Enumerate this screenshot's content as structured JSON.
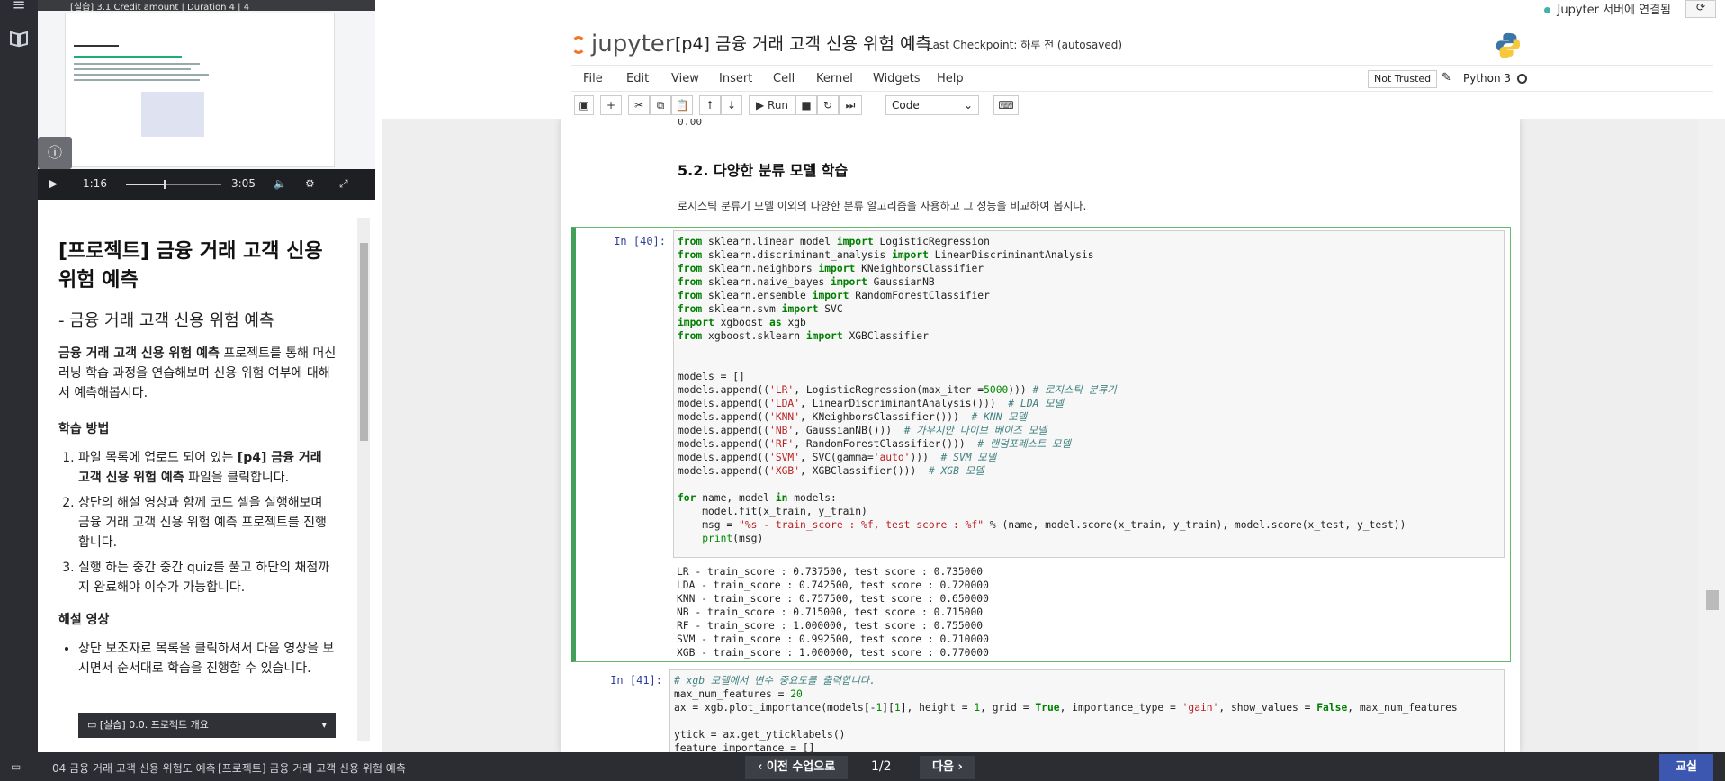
{
  "rail": {
    "icons": [
      "menu-icon",
      "book-icon"
    ]
  },
  "video": {
    "thumb_title": "[실습] 3.1 Credit amount | Duration 4 | 4",
    "current_time": "1:16",
    "total_time": "3:05",
    "progress": 0.41
  },
  "lesson": {
    "title": "[프로젝트] 금융 거래 고객 신용 위험 예측",
    "subtitle": "- 금융 거래 고객 신용 위험 예측",
    "intro_bold": "금융 거래 고객 신용 위험 예측",
    "intro_rest": " 프로젝트를 통해 머신러닝 학습 과정을 연습해보며 신용 위험 여부에 대해서 예측해봅시다.",
    "method_heading": "학습 방법",
    "steps": [
      {
        "pre": "파일 목록에 업로드 되어 있는 ",
        "bold": "[p4] 금융 거래 고객 신용 위험 예측",
        "post": " 파일을 클릭합니다."
      },
      {
        "pre": "상단의 해설 영상과 함께 코드 셀을 실행해보며 금융 거래 고객 신용 위험 예측 프로젝트를 진행합니다.",
        "bold": "",
        "post": ""
      },
      {
        "pre": "실행 하는 중간 중간 quiz를 풀고 하단의 채점까지 완료해야 이수가 가능합니다.",
        "bold": "",
        "post": ""
      }
    ],
    "video_heading": "해설 영상",
    "video_bullet": "상단 보조자료 목록을 클릭하셔서 다음 영상을 보시면서 순서대로 학습을 진행할 수 있습니다.",
    "dropdown_label": "[실습] 0.0. 프로젝트 개요"
  },
  "jupyter": {
    "connection": "Jupyter 서버에 연결됨",
    "logo": "jupyter",
    "notebook_title": "[p4] 금융 거래 고객 신용 위험 예측",
    "checkpoint": "Last Checkpoint: 하루 전  (autosaved)",
    "menu": [
      "File",
      "Edit",
      "View",
      "Insert",
      "Cell",
      "Kernel",
      "Widgets",
      "Help"
    ],
    "trust": "Not Trusted",
    "kernel": "Python 3",
    "run_label": "Run",
    "cell_type": "Code"
  },
  "notebook": {
    "prev_output_tail": "0.00",
    "heading": "5.2. 다양한 분류 모델 학습",
    "paragraph": "로지스틱 분류기 모델 이외의 다양한 분류 알고리즘을 사용하고 그 성능을 비교하여 봅시다.",
    "cell40_prompt": "In [40]:",
    "cell41_prompt": "In [41]:",
    "outputs": [
      "LR - train_score : 0.737500, test score : 0.735000",
      "LDA - train_score : 0.742500, test score : 0.720000",
      "KNN - train_score : 0.757500, test score : 0.650000",
      "NB - train_score : 0.715000, test score : 0.715000",
      "RF - train_score : 1.000000, test score : 0.755000",
      "SVM - train_score : 0.992500, test score : 0.710000",
      "XGB - train_score : 1.000000, test score : 0.770000"
    ]
  },
  "bottom": {
    "crumb1": "04 금융 거래 고객 신용 위험도 예측",
    "crumb2": "[프로젝트] 금융 거래 고객 신용 위험 예측",
    "prev": "이전 수업으로",
    "page": "1/2",
    "next": "다음",
    "classroom": "교실"
  }
}
